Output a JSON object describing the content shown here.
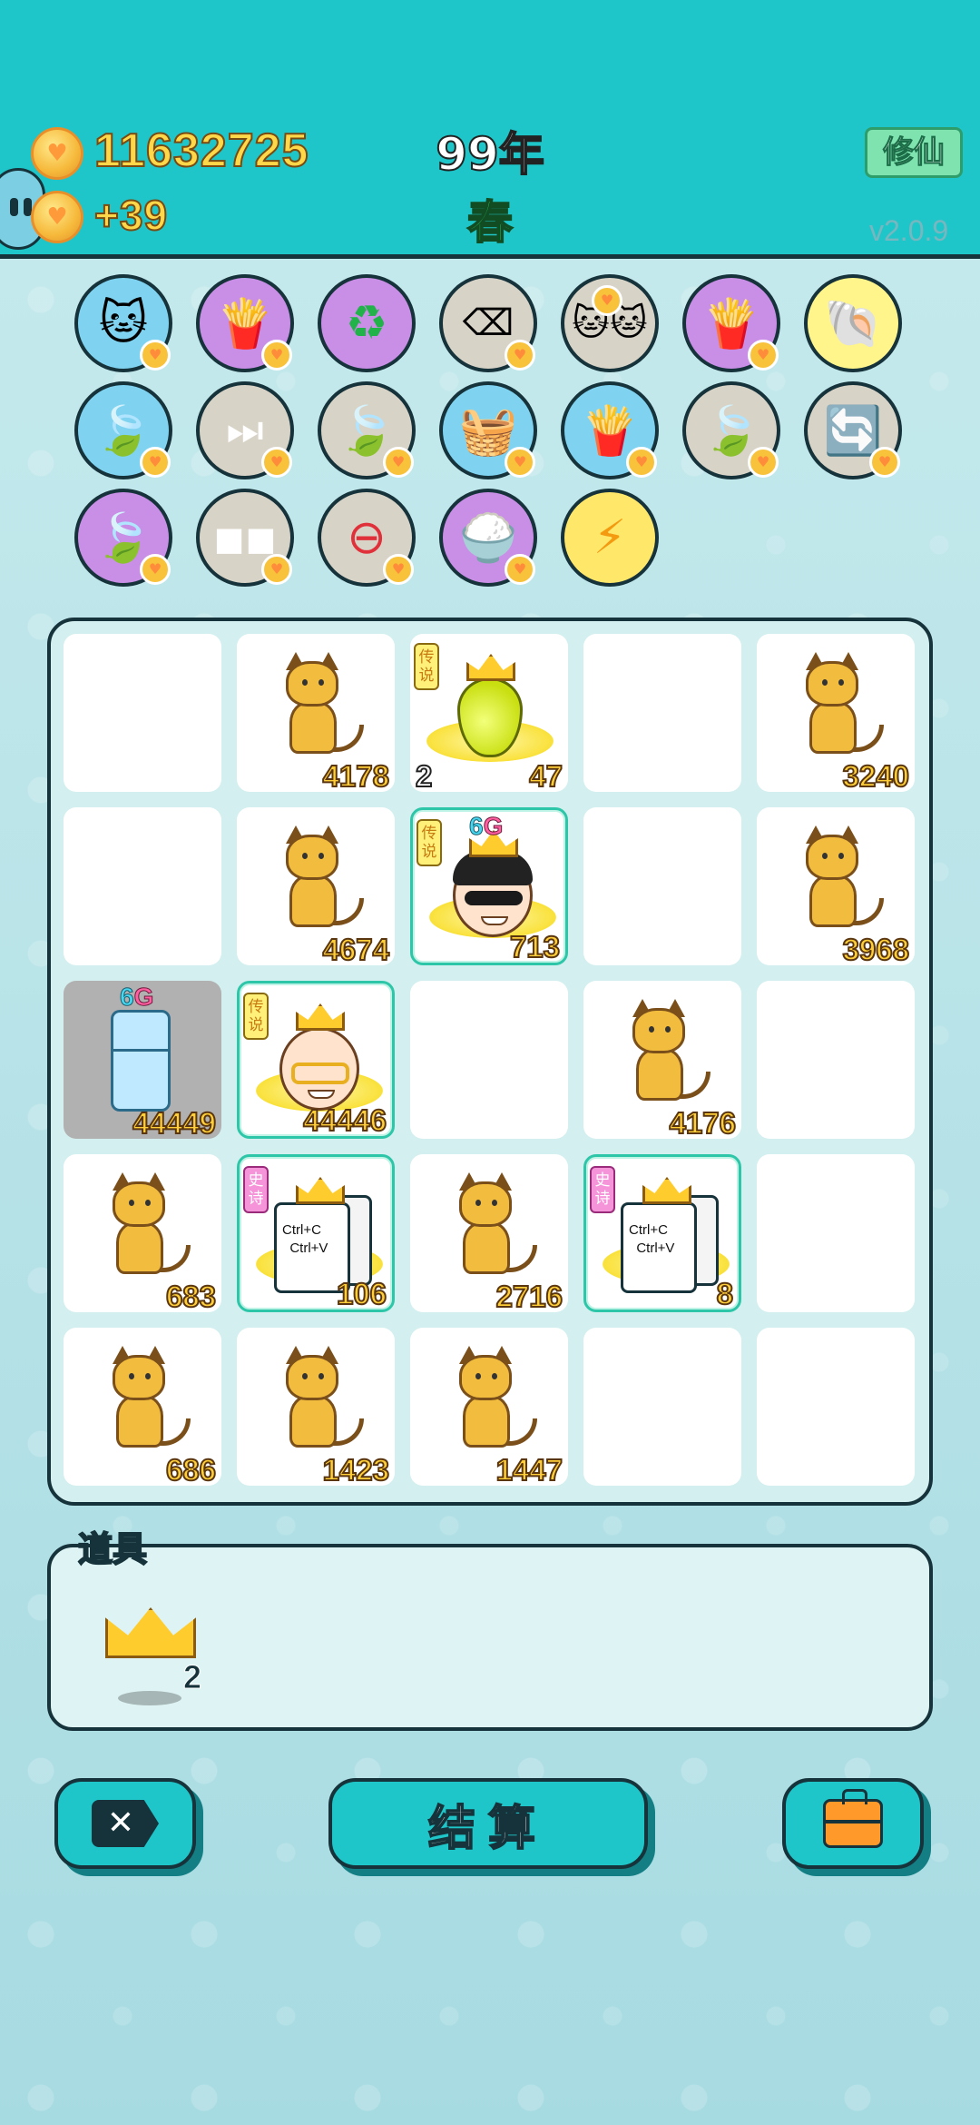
{
  "header": {
    "coins": "11632725",
    "coin_rate": "+39",
    "year": "99年",
    "season": "春",
    "xiuxian_button": "修仙",
    "version": "v2.0.9"
  },
  "skills": [
    {
      "icon": "cat-icon",
      "color": "blue"
    },
    {
      "icon": "fries-icon",
      "color": "purple"
    },
    {
      "icon": "recycle-icon",
      "color": "purple"
    },
    {
      "icon": "delete-tag-icon",
      "color": "grey"
    },
    {
      "icon": "twin-cats-icon",
      "color": "grey"
    },
    {
      "icon": "fries-icon",
      "color": "purple"
    },
    {
      "icon": "shell-icon",
      "color": "yellow"
    },
    {
      "icon": "leaf-icon",
      "color": "blue"
    },
    {
      "icon": "skip-icon",
      "color": "grey"
    },
    {
      "icon": "leaf-icon",
      "color": "grey"
    },
    {
      "icon": "basket-icon",
      "color": "blue"
    },
    {
      "icon": "fries-icon",
      "color": "blue"
    },
    {
      "icon": "leaf-icon",
      "color": "grey"
    },
    {
      "icon": "refresh-icon",
      "color": "grey"
    },
    {
      "icon": "leaf-icon",
      "color": "purple"
    },
    {
      "icon": "cubes-icon",
      "color": "grey"
    },
    {
      "icon": "minus-icon",
      "color": "grey"
    },
    {
      "icon": "rice-bowl-icon",
      "color": "purple"
    },
    {
      "icon": "lightning-icon",
      "color": "gold"
    }
  ],
  "board": {
    "cells": [
      {
        "type": "empty"
      },
      {
        "type": "cat",
        "value": "4178"
      },
      {
        "type": "pear",
        "tag": "传说",
        "level": "2",
        "value": "47"
      },
      {
        "type": "empty"
      },
      {
        "type": "cat",
        "value": "3240"
      },
      {
        "type": "empty"
      },
      {
        "type": "cat",
        "value": "4674"
      },
      {
        "type": "man",
        "tag": "传说",
        "badge_a": "6",
        "badge_b": "G",
        "value": "713"
      },
      {
        "type": "empty"
      },
      {
        "type": "cat",
        "value": "3968"
      },
      {
        "type": "fridge",
        "badge_a": "6",
        "badge_b": "G",
        "value": "44449"
      },
      {
        "type": "oldman",
        "tag": "传说",
        "value": "44446"
      },
      {
        "type": "empty"
      },
      {
        "type": "cat",
        "value": "4176"
      },
      {
        "type": "empty"
      },
      {
        "type": "cat",
        "value": "683"
      },
      {
        "type": "paper",
        "tag": "史诗",
        "line1": "Ctrl+C",
        "line2": "Ctrl+V",
        "value": "106"
      },
      {
        "type": "cat",
        "value": "2716"
      },
      {
        "type": "paper",
        "tag": "史诗",
        "line1": "Ctrl+C",
        "line2": "Ctrl+V",
        "value": "8"
      },
      {
        "type": "empty"
      },
      {
        "type": "cat",
        "value": "686"
      },
      {
        "type": "cat",
        "value": "1423"
      },
      {
        "type": "cat",
        "value": "1447"
      },
      {
        "type": "empty"
      },
      {
        "type": "empty"
      }
    ]
  },
  "props": {
    "label": "道具",
    "item_count": "2"
  },
  "buttons": {
    "delete_symbol": "✕",
    "settle_label": "结算"
  }
}
